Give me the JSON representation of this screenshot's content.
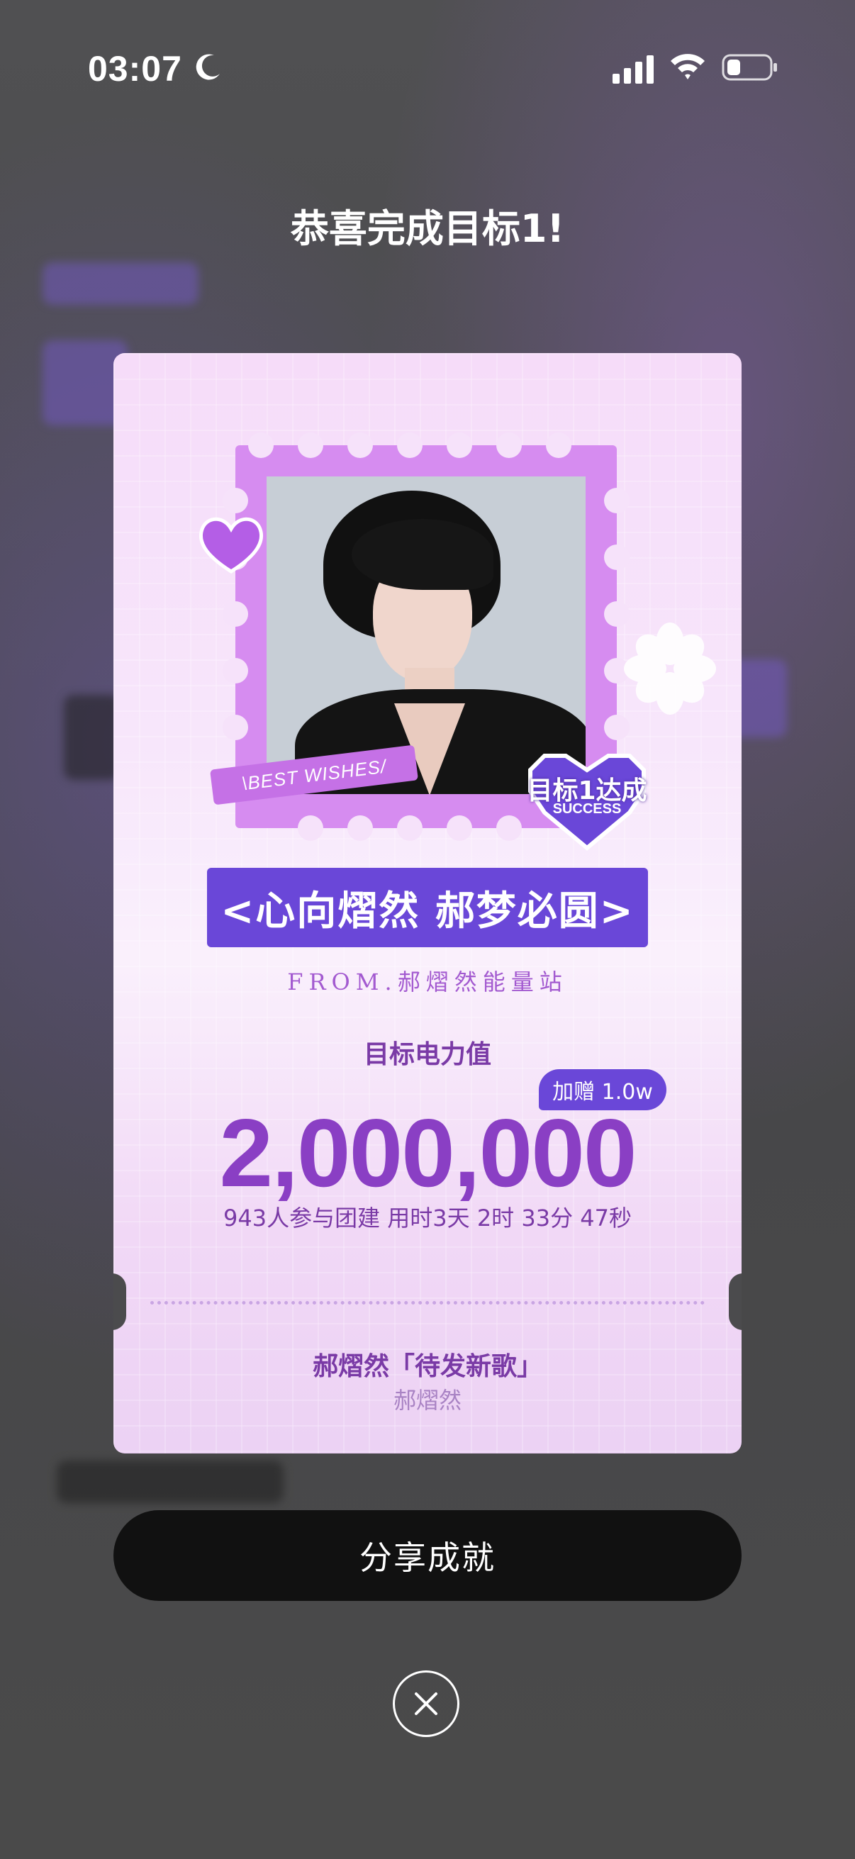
{
  "status_bar": {
    "time": "03:07"
  },
  "title": "恭喜完成目标1!",
  "card": {
    "ribbon_text": "\\BEST WISHES/",
    "badge": {
      "main": "目标1达成",
      "sub": "SUCCESS"
    },
    "banner": "<心向熠然 郝梦必圆>",
    "from": "FROM.郝熠然能量站",
    "target_label": "目标电力值",
    "bonus": "加赠 1.0w",
    "target_value": "2,000,000",
    "stats": "943人参与团建 用时3天 2时 33分 47秒",
    "song_title": "郝熠然「待发新歌」",
    "song_artist": "郝熠然"
  },
  "share_button": "分享成就",
  "colors": {
    "accent": "#6a47d8",
    "number": "#8a3fc4",
    "stamp": "#d68cf0"
  },
  "icons": [
    "moon-icon",
    "signal-icon",
    "wifi-icon",
    "battery-icon",
    "heart-icon",
    "flower-icon",
    "close-icon"
  ]
}
